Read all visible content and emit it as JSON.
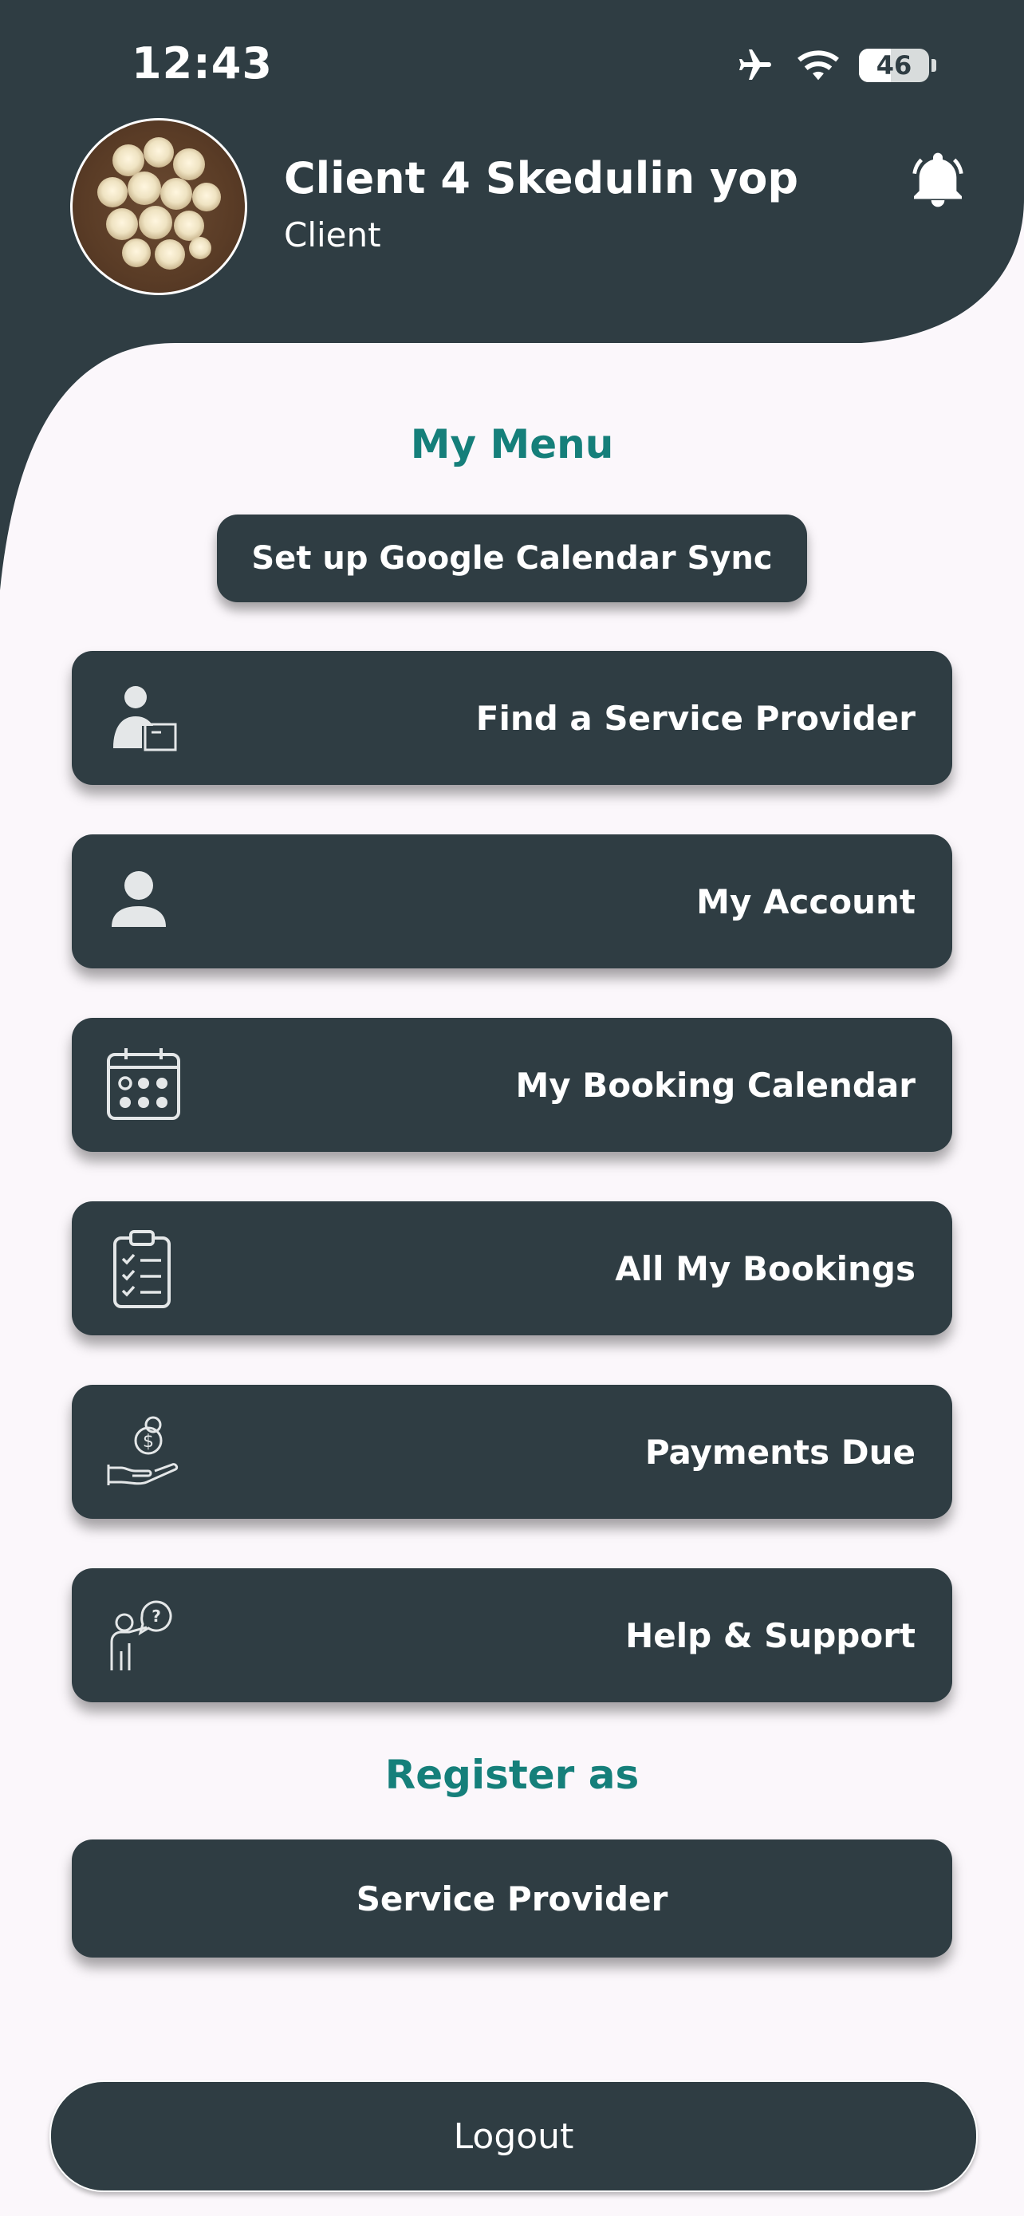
{
  "status_bar": {
    "time": "12:43",
    "battery_level": "46",
    "icons": [
      "airplane-icon",
      "wifi-icon",
      "battery-icon"
    ]
  },
  "profile": {
    "name": "Client 4 Skedulin yop",
    "role": "Client"
  },
  "menu": {
    "title": "My Menu",
    "sync_button": "Set up Google Calendar Sync",
    "items": [
      {
        "label": "Find a Service Provider",
        "icon": "find-provider-icon"
      },
      {
        "label": "My Account",
        "icon": "person-icon"
      },
      {
        "label": "My Booking Calendar",
        "icon": "calendar-icon"
      },
      {
        "label": "All My Bookings",
        "icon": "clipboard-checklist-icon"
      },
      {
        "label": "Payments Due",
        "icon": "hand-money-icon"
      },
      {
        "label": "Help & Support",
        "icon": "help-support-icon"
      }
    ]
  },
  "register": {
    "title": "Register as",
    "button": "Service Provider"
  },
  "logout": {
    "label": "Logout"
  },
  "colors": {
    "dark": "#2f3d43",
    "accent": "#157f7a",
    "background": "#fbf7fb"
  }
}
